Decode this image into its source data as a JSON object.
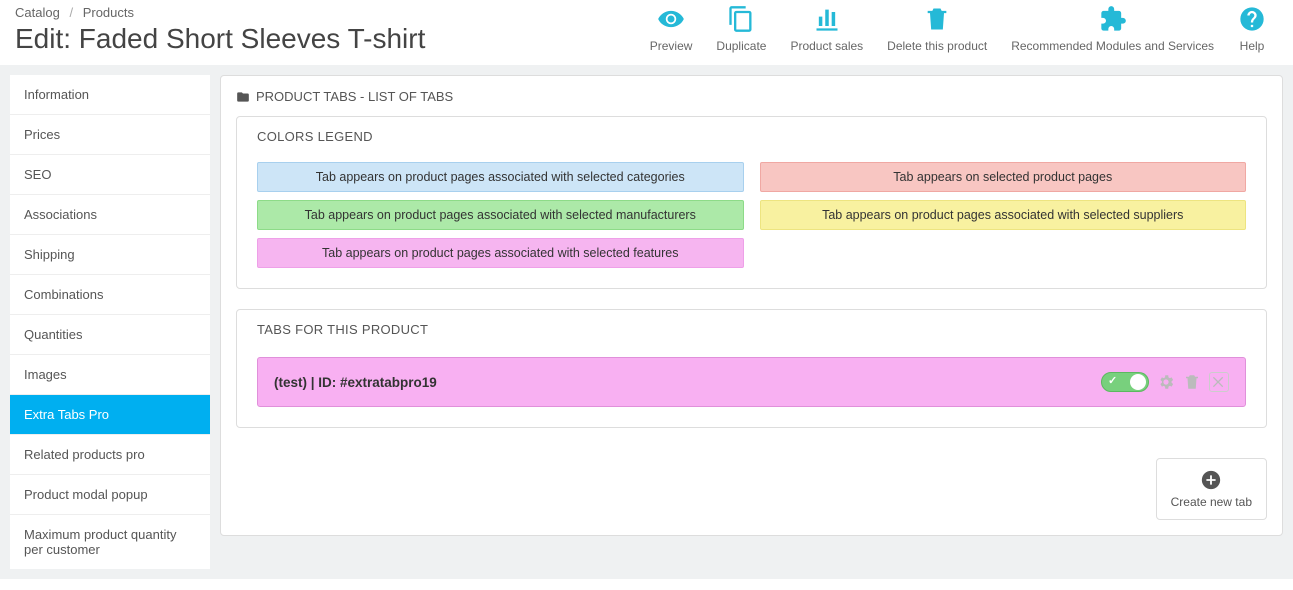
{
  "breadcrumb": {
    "item1": "Catalog",
    "item2": "Products"
  },
  "page_title": "Edit: Faded Short Sleeves T-shirt",
  "toolbar": {
    "preview": "Preview",
    "duplicate": "Duplicate",
    "sales": "Product sales",
    "delete": "Delete this product",
    "modules": "Recommended Modules and Services",
    "help": "Help"
  },
  "sidebar": {
    "items": [
      "Information",
      "Prices",
      "SEO",
      "Associations",
      "Shipping",
      "Combinations",
      "Quantities",
      "Images",
      "Extra Tabs Pro",
      "Related products pro",
      "Product modal popup",
      "Maximum product quantity per customer"
    ],
    "active_index": 8
  },
  "panel_title": "PRODUCT TABS - LIST OF TABS",
  "legend": {
    "heading": "COLORS LEGEND",
    "blue": "Tab appears on product pages associated with selected categories",
    "red": "Tab appears on selected product pages",
    "green": "Tab appears on product pages associated with selected manufacturers",
    "yellow": "Tab appears on product pages associated with selected suppliers",
    "pink": "Tab appears on product pages associated with selected features"
  },
  "tabs_panel": {
    "heading": "TABS FOR THIS PRODUCT",
    "row_label": "(test) | ID: #extratabpro19"
  },
  "create_btn": "Create new tab"
}
